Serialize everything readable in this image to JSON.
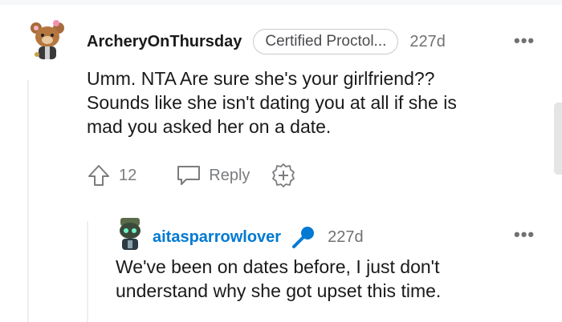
{
  "comments": [
    {
      "username": "ArcheryOnThursday",
      "flair": "Certified Proctol...",
      "time": "227d",
      "more": "•••",
      "body_lines": [
        "Umm. NTA Are sure she's your girlfriend??",
        "Sounds like she isn't dating you at all if she is",
        "mad you asked her on a date."
      ],
      "upvotes": "12",
      "reply_label": "Reply"
    },
    {
      "username": "aitasparrowlover",
      "time": "227d",
      "more": "•••",
      "body_lines": [
        "We've been on dates before, I just don't",
        "understand why she got upset this time."
      ]
    }
  ],
  "colors": {
    "op_blue": "#0079d3",
    "muted": "#7a7c7f"
  }
}
